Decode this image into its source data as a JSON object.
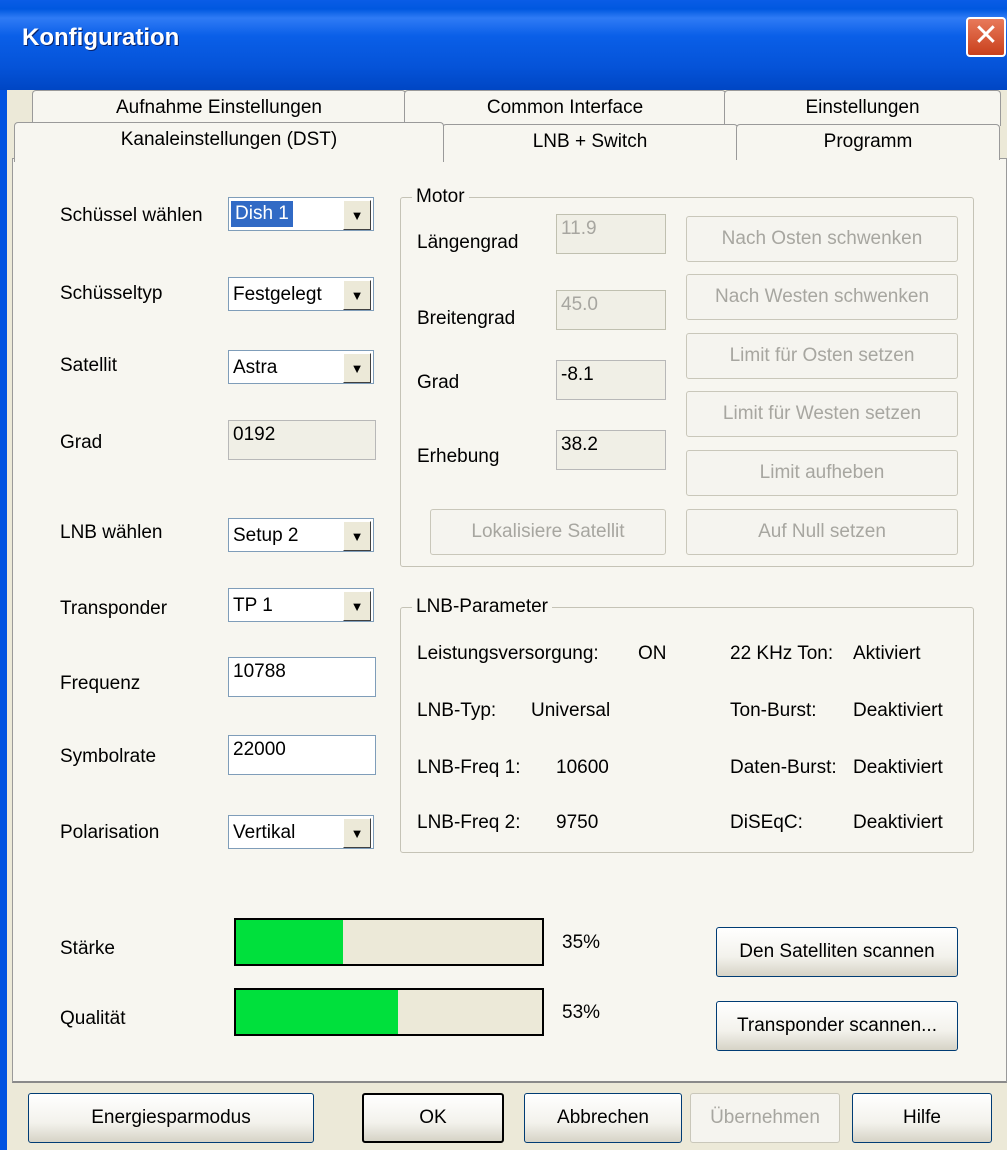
{
  "window": {
    "title": "Konfiguration",
    "close_glyph": "✕"
  },
  "tabs": {
    "row1": [
      "Aufnahme Einstellungen",
      "Common Interface",
      "Einstellungen"
    ],
    "row2": [
      "Kanaleinstellungen  (DST)",
      "LNB + Switch",
      "Programm"
    ]
  },
  "left": {
    "dish": {
      "label": "Schüssel wählen",
      "value": "Dish 1"
    },
    "dishtype": {
      "label": "Schüsseltyp",
      "value": "Festgelegt"
    },
    "satellite": {
      "label": "Satellit",
      "value": "Astra"
    },
    "grad": {
      "label": "Grad",
      "value": "0192"
    },
    "lnb": {
      "label": "LNB wählen",
      "value": "Setup 2"
    },
    "transponder": {
      "label": "Transponder",
      "value": "TP 1"
    },
    "frequenz": {
      "label": "Frequenz",
      "value": "10788"
    },
    "symbolrate": {
      "label": "Symbolrate",
      "value": "22000"
    },
    "polarisation": {
      "label": "Polarisation",
      "value": "Vertikal"
    }
  },
  "motor": {
    "legend": "Motor",
    "laengengrad": {
      "label": "Längengrad",
      "value": "11.9"
    },
    "breitengrad": {
      "label": "Breitengrad",
      "value": "45.0"
    },
    "grad": {
      "label": "Grad",
      "value": "-8.1"
    },
    "erhebung": {
      "label": "Erhebung",
      "value": "38.2"
    },
    "buttons": {
      "east": "Nach Osten schwenken",
      "west": "Nach Westen schwenken",
      "limit_east": "Limit für Osten setzen",
      "limit_west": "Limit für Westen setzen",
      "limit_clear": "Limit aufheben",
      "zero": "Auf Null setzen",
      "locate": "Lokalisiere Satellit"
    }
  },
  "lnbparams": {
    "legend": "LNB-Parameter",
    "power": {
      "label": "Leistungsversorgung:",
      "value": "ON"
    },
    "tone22": {
      "label": "22 KHz Ton:",
      "value": "Aktiviert"
    },
    "lnbtype": {
      "label": "LNB-Typ:",
      "value": "Universal"
    },
    "toneburst": {
      "label": "Ton-Burst:",
      "value": "Deaktiviert"
    },
    "freq1": {
      "label": "LNB-Freq 1:",
      "value": "10600"
    },
    "databurst": {
      "label": "Daten-Burst:",
      "value": "Deaktiviert"
    },
    "freq2": {
      "label": "LNB-Freq 2:",
      "value": "9750"
    },
    "diseqc": {
      "label": "DiSEqC:",
      "value": "Deaktiviert"
    }
  },
  "signal": {
    "strength": {
      "label": "Stärke",
      "value_text": "35%",
      "fraction": 0.35
    },
    "quality": {
      "label": "Qualität",
      "value_text": "53%",
      "fraction": 0.53
    },
    "fill_color": "#00e03c",
    "scan_satellite": "Den Satelliten scannen",
    "scan_transponder": "Transponder scannen..."
  },
  "footer": {
    "energy": "Energiesparmodus",
    "ok": "OK",
    "cancel": "Abbrechen",
    "apply": "Übernehmen",
    "help": "Hilfe"
  }
}
